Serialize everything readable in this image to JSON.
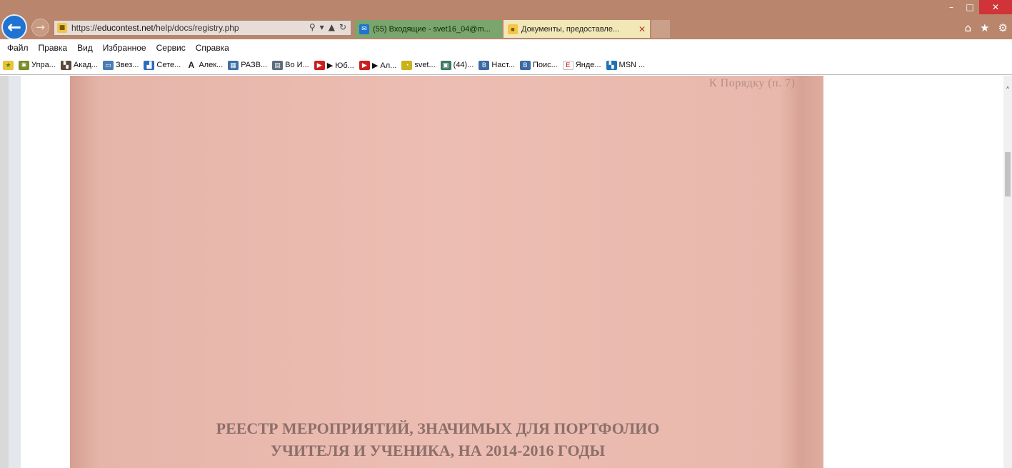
{
  "browser": {
    "address": {
      "url_prefix": "https://",
      "url_domain": "educontest.net",
      "url_path": "/help/docs/registry.php",
      "icons": [
        "search-icon",
        "dropdown-icon",
        "lock-icon",
        "refresh-icon"
      ]
    },
    "tabs": [
      {
        "label": "(55) Входящие - svet16_04@m..."
      },
      {
        "label": "Документы, предоставле...",
        "close": "✕"
      }
    ],
    "window_controls": [
      "minimize",
      "restore",
      "close"
    ],
    "right_icons": [
      "home-icon",
      "favorites-star-icon",
      "settings-gear-icon"
    ]
  },
  "menubar": {
    "items": [
      "Файл",
      "Правка",
      "Вид",
      "Избранное",
      "Сервис",
      "Справка"
    ]
  },
  "favorites": [
    {
      "label": "Упра...",
      "color": "#7a8f2b",
      "glyph": "✱"
    },
    {
      "label": "Акад...",
      "color": "#5a4a3a",
      "glyph": "▚"
    },
    {
      "label": "Звез...",
      "color": "#4a7bb5",
      "glyph": "▭"
    },
    {
      "label": "Сете...",
      "color": "#2b6bc4",
      "glyph": "▟"
    },
    {
      "label": "Алек...",
      "color": "#222222",
      "glyph": "A"
    },
    {
      "label": "РАЗВ...",
      "color": "#3d6fa8",
      "glyph": "▦"
    },
    {
      "label": "Во И...",
      "color": "#5d6b7c",
      "glyph": "▤"
    },
    {
      "label": "▶ Юб...",
      "color": "#cc1f1f",
      "glyph": "▶"
    },
    {
      "label": "▶ Ал...",
      "color": "#cc1f1f",
      "glyph": "▶"
    },
    {
      "label": "svet...",
      "color": "#c9b21a",
      "glyph": "◔"
    },
    {
      "label": "(44)...",
      "color": "#3f7a5e",
      "glyph": "▣"
    },
    {
      "label": "Наст...",
      "color": "#3c6aa7",
      "glyph": "B"
    },
    {
      "label": "Поис...",
      "color": "#3c6aa7",
      "glyph": "B"
    },
    {
      "label": "Янде...",
      "color": "#d9d9d9",
      "glyph": "Е"
    },
    {
      "label": "MSN ...",
      "color": "#1e73b8",
      "glyph": "▚"
    }
  ],
  "document": {
    "note": "К Порядку (п. 7)",
    "title_line1": "РЕЕСТР МЕРОПРИЯТИЙ, ЗНАЧИМЫХ ДЛЯ ПОРТФОЛИО",
    "title_line2": "УЧИТЕЛЯ И УЧЕНИКА, НА 2014-2016 ГОДЫ"
  }
}
